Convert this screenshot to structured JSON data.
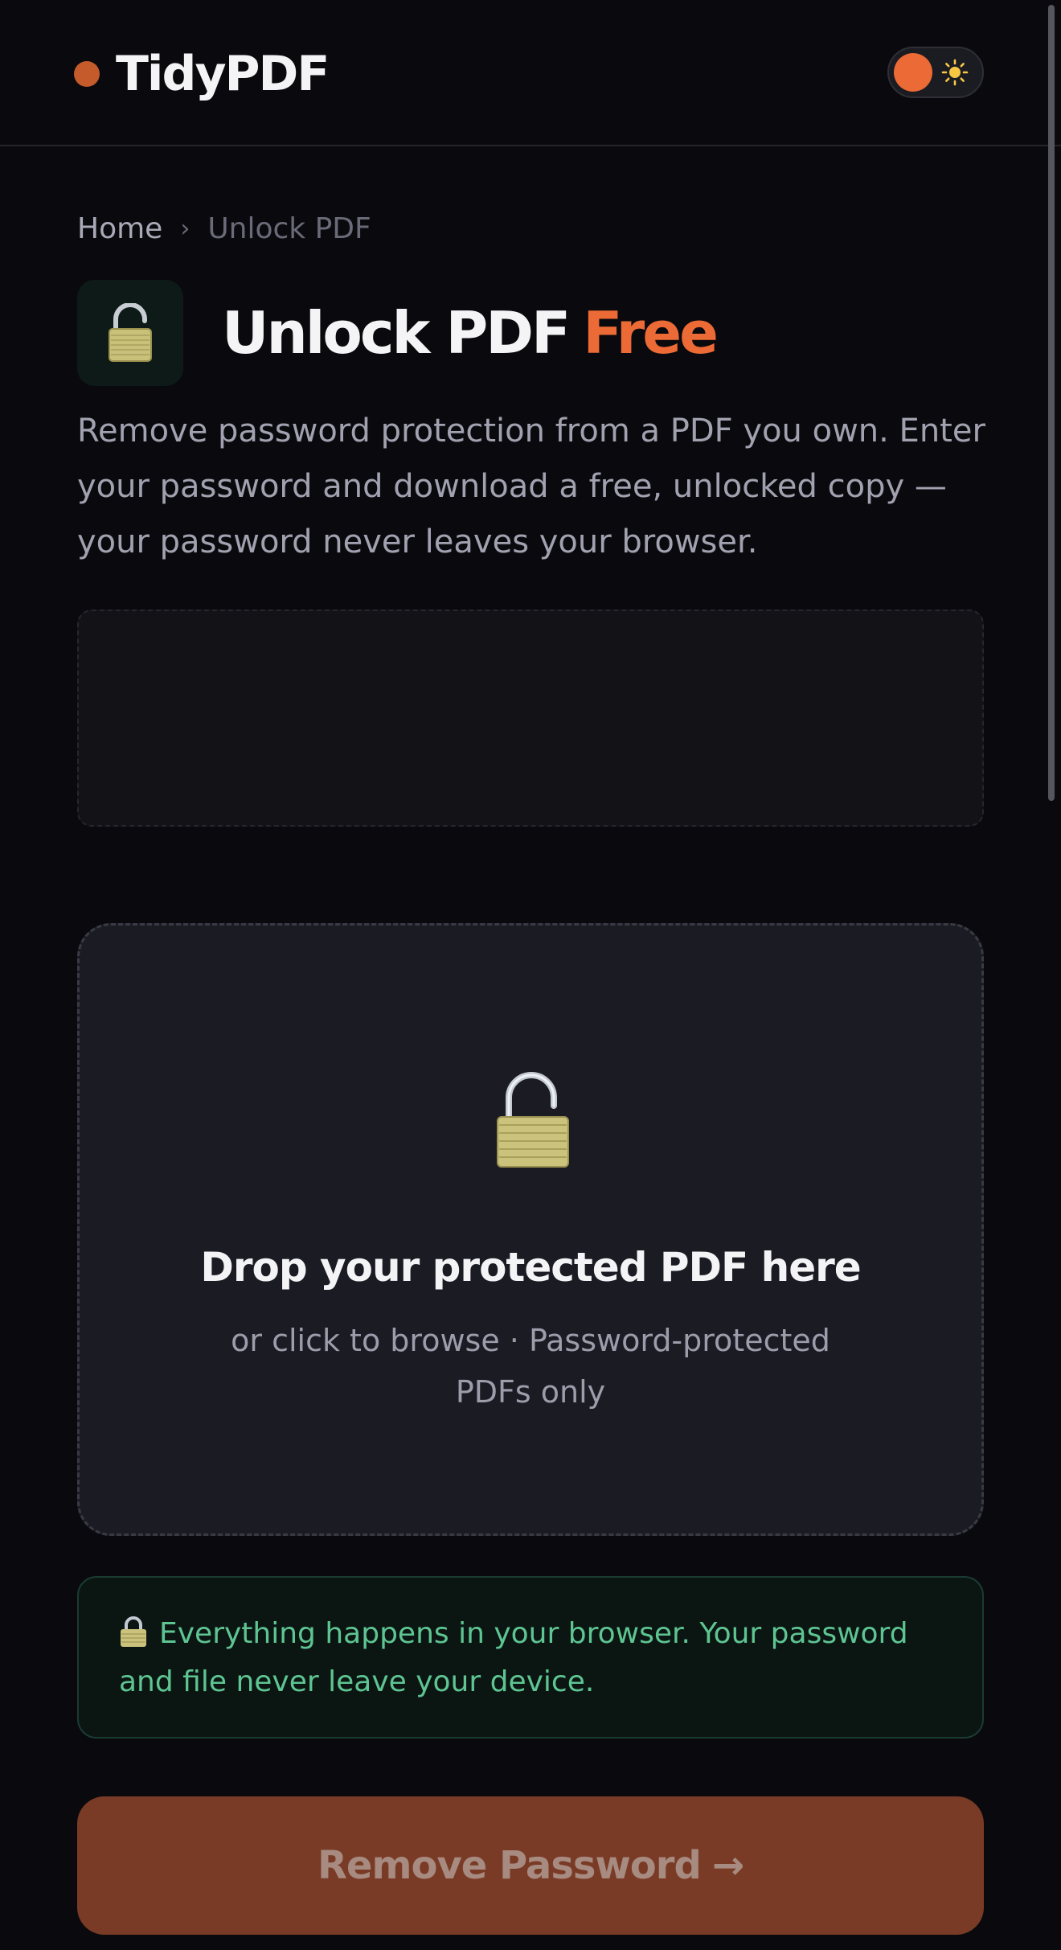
{
  "header": {
    "brand_name": "TidyPDF",
    "brand_dot_color": "#c55a2b",
    "theme_toggle_icon": "sun-icon"
  },
  "breadcrumb": {
    "home": "Home",
    "separator": "›",
    "current": "Unlock PDF"
  },
  "page": {
    "icon": "unlocked-padlock-icon",
    "title_main": "Unlock PDF",
    "title_accent": "Free",
    "accent_color": "#ec6a35",
    "description": "Remove password protection from a PDF you own. Enter your password and download a free, unlocked copy — your password never leaves your browser."
  },
  "dropzone": {
    "icon": "unlocked-padlock-icon",
    "title": "Drop your protected PDF here",
    "subtitle": "or click to browse · Password-protected PDFs only"
  },
  "privacy_note": {
    "icon": "padlock-icon",
    "text": "Everything happens in your browser. Your password and file never leave your device.",
    "color": "#5ec592"
  },
  "action": {
    "label": "Remove Password",
    "arrow": "→"
  }
}
